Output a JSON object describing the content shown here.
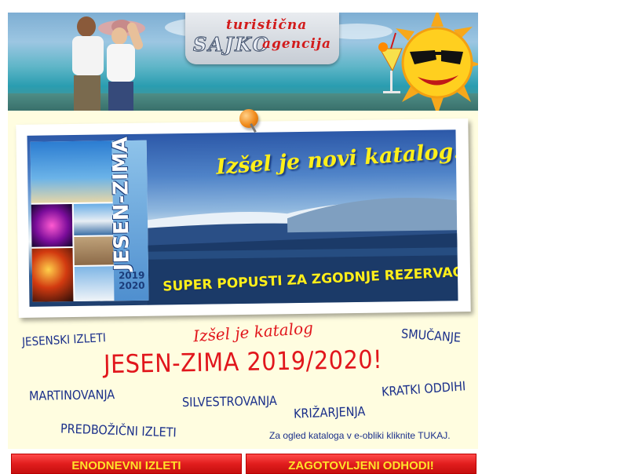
{
  "header": {
    "logo_line1": "turistična",
    "logo_name": "SAJKO",
    "logo_line2": "agencija"
  },
  "catalog": {
    "cover_title": "JESEN-ZIMA",
    "cover_year_1": "2019",
    "cover_year_2": "2020",
    "slogan": "Izšel je novi katalog!",
    "promo": "SUPER POPUSTI ZA ZGODNJE REZERVACIJE!"
  },
  "words": {
    "jesenski": "JESENSKI IZLETI",
    "smucanje": "SMUČANJE",
    "izsel": "Izšel je katalog",
    "headline": "JESEN-ZIMA 2019/2020!",
    "martinovanja": "MARTINOVANJA",
    "silvestrovanja": "SILVESTROVANJA",
    "kratki": "KRATKI ODDIHI",
    "krizarjenja": "KRIŽARJENJA",
    "predbozicni": "PREDBOŽIČNI IZLETI"
  },
  "link_text": "Za ogled kataloga v e-obliki kliknite TUKAJ.",
  "buttons": {
    "enodnevni": "ENODNEVNI IZLETI",
    "zagotovljeni": "ZAGOTOVLJENI ODHODI!"
  },
  "colors": {
    "headline_red": "#e1161c",
    "word_blue": "#1a2f8a",
    "content_bg": "#fffde0",
    "button_red": "#e11d1d",
    "button_text": "#ffe22a"
  }
}
